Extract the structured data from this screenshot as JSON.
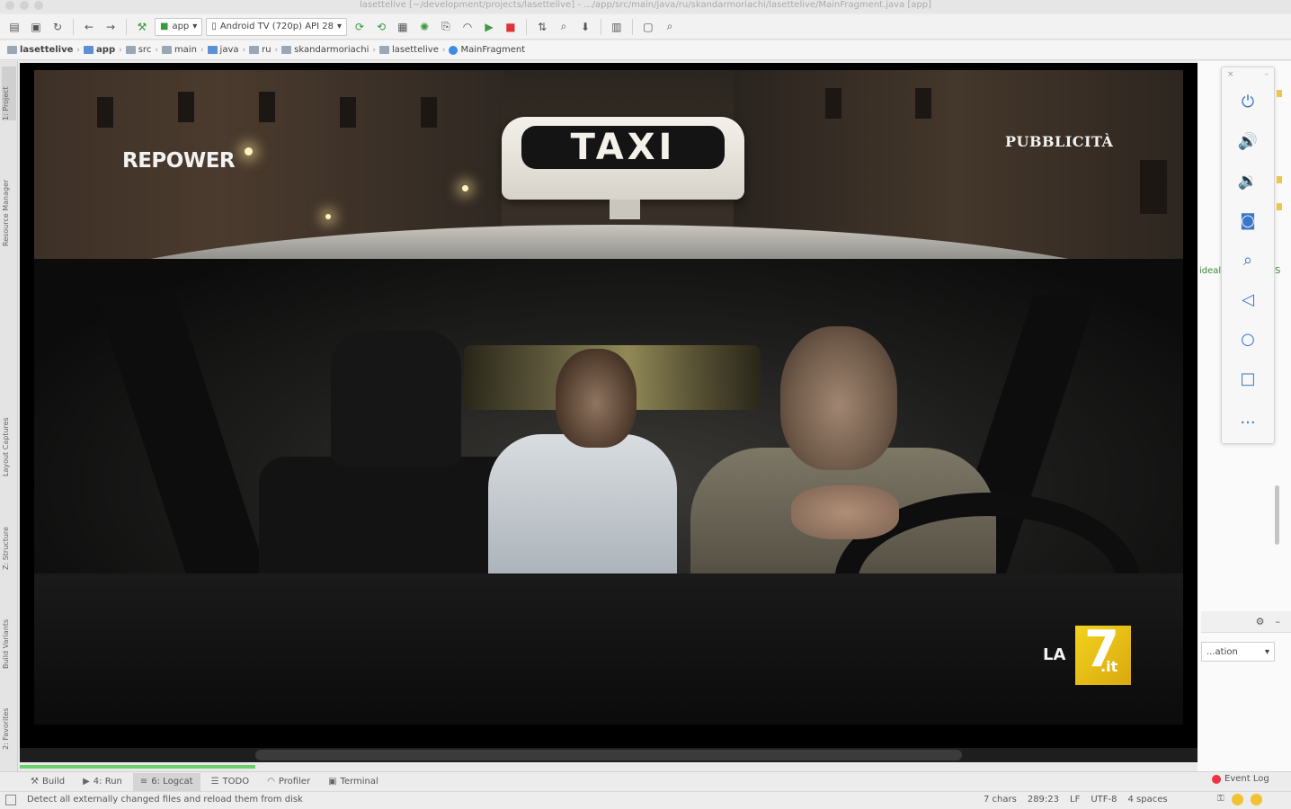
{
  "titlebar": {
    "text": "lasettelive [~/development/projects/lasettelive] - .../app/src/main/java/ru/skandarmoriachi/lasettelive/MainFragment.java [app]"
  },
  "toolbar": {
    "module_combo": "app",
    "device_combo": "Android TV (720p) API 28"
  },
  "breadcrumbs": [
    "lasettelive",
    "app",
    "src",
    "main",
    "java",
    "ru",
    "skandarmoriachi",
    "lasettelive",
    "MainFragment"
  ],
  "left_tabs": {
    "project": "1: Project",
    "resource_manager": "Resource Manager",
    "layout_captures": "Layout Captures",
    "structure": "Z: Structure",
    "build_variants": "Build Variants",
    "favorites": "2: Favorites"
  },
  "video": {
    "taxi_sign": "TAXI",
    "brand_overlay": "REPOWER",
    "ad_label": "PUBBLICITÀ",
    "channel_logo": {
      "prefix": "LA",
      "number": "7",
      "suffix": ".it"
    },
    "progress_fraction": 0.2
  },
  "emulator_panel": {
    "close": "×",
    "minimize": "–",
    "more": "..."
  },
  "right_panel": {
    "code_fragment": "ideal",
    "code_fragment2": "S",
    "config_combo": "...ation"
  },
  "bottom_tabs": [
    {
      "label": "Build",
      "icon": "hammer-icon"
    },
    {
      "label": "4: Run",
      "icon": "run-icon"
    },
    {
      "label": "6: Logcat",
      "icon": "logcat-icon"
    },
    {
      "label": "TODO",
      "icon": "todo-icon"
    },
    {
      "label": "Profiler",
      "icon": "profiler-icon"
    },
    {
      "label": "Terminal",
      "icon": "terminal-icon"
    }
  ],
  "event_log": "Event Log",
  "status": {
    "message": "Detect all externally changed files and reload them from disk",
    "chars": "7 chars",
    "position": "289:23",
    "line_sep": "LF",
    "encoding": "UTF-8",
    "indent": "4 spaces"
  }
}
